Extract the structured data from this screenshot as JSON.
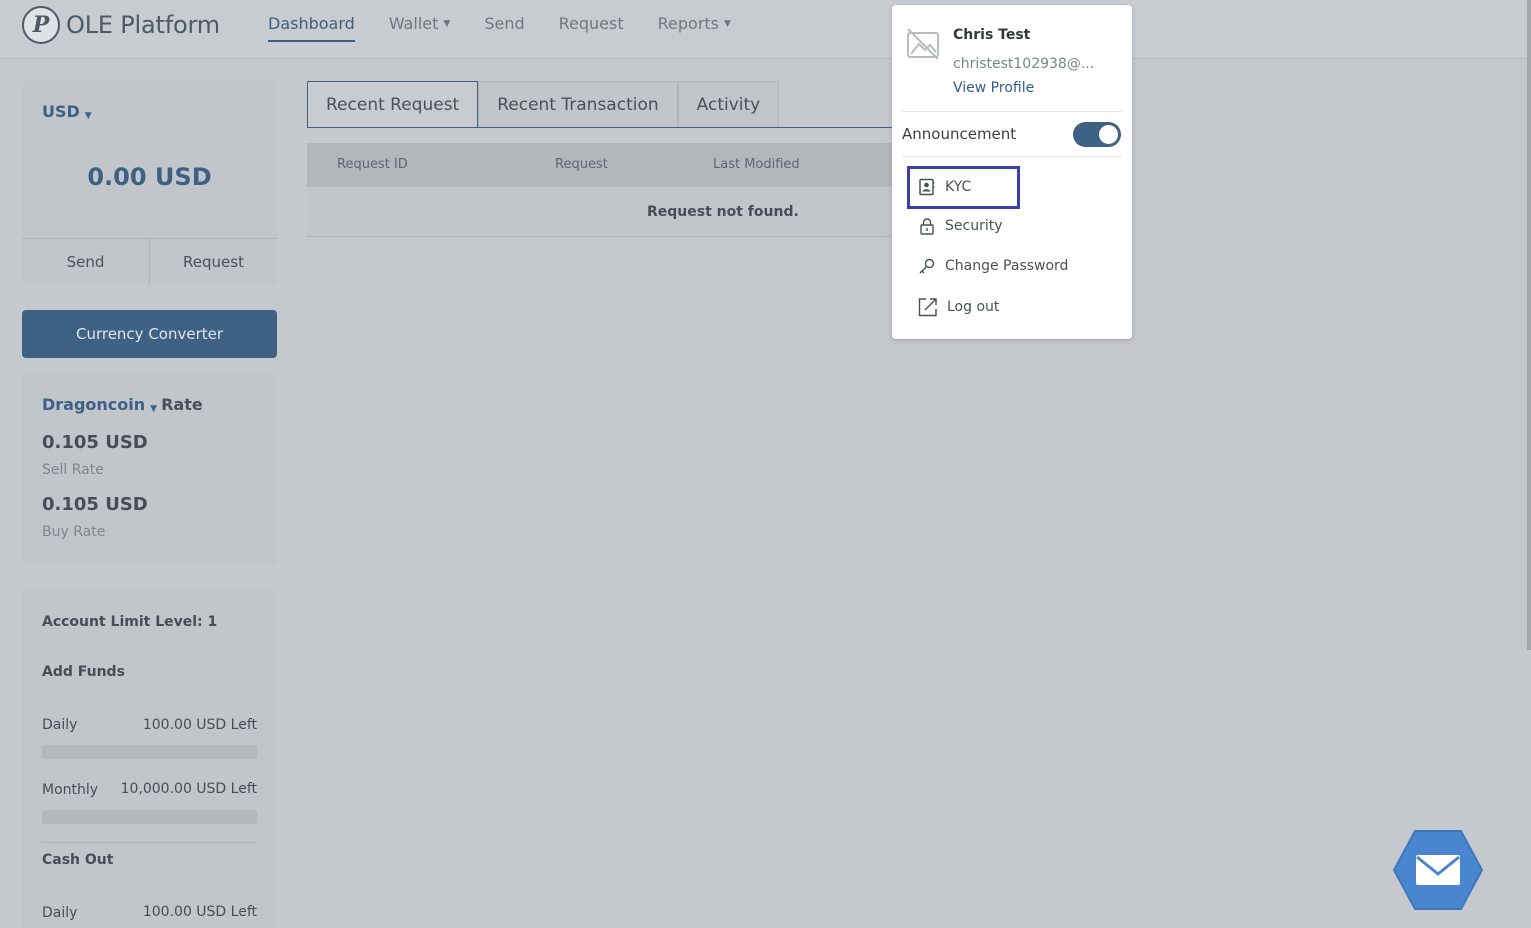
{
  "brand": {
    "logo_letter": "P",
    "name": "OLE Platform"
  },
  "nav": {
    "items": [
      {
        "label": "Dashboard",
        "active": true,
        "has_caret": false
      },
      {
        "label": "Wallet",
        "active": false,
        "has_caret": true
      },
      {
        "label": "Send",
        "active": false,
        "has_caret": false
      },
      {
        "label": "Request",
        "active": false,
        "has_caret": false
      },
      {
        "label": "Reports",
        "active": false,
        "has_caret": true
      }
    ]
  },
  "balance": {
    "currency": "USD",
    "amount": "0.00 USD",
    "send_label": "Send",
    "request_label": "Request"
  },
  "converter": {
    "label": "Currency Converter"
  },
  "rate": {
    "coin": "Dragoncoin",
    "rate_word": "Rate",
    "sell_value": "0.105 USD",
    "sell_label": "Sell Rate",
    "buy_value": "0.105 USD",
    "buy_label": "Buy Rate"
  },
  "limits": {
    "level_label": "Account Limit Level: 1",
    "add_funds_label": "Add Funds",
    "add_daily_label": "Daily",
    "add_daily_value": "100.00 USD Left",
    "add_daily_used_fraction": 0,
    "add_monthly_label": "Monthly",
    "add_monthly_value": "10,000.00 USD Left",
    "add_monthly_used_fraction": 0,
    "cash_out_label": "Cash Out",
    "cash_daily_label": "Daily",
    "cash_daily_value": "100.00 USD Left"
  },
  "tabs": [
    {
      "label": "Recent Request",
      "active": true
    },
    {
      "label": "Recent Transaction",
      "active": false
    },
    {
      "label": "Activity",
      "active": false
    }
  ],
  "table": {
    "columns": [
      "Request ID",
      "Request",
      "Last Modified"
    ],
    "empty_message": "Request not found."
  },
  "profile_menu": {
    "user_name": "Chris Test",
    "user_email": "christest102938@...",
    "view_profile": "View Profile",
    "announcement_label": "Announcement",
    "announcement_on": true,
    "items": [
      {
        "label": "KYC",
        "icon": "id-card-icon"
      },
      {
        "label": "Security",
        "icon": "lock-icon"
      },
      {
        "label": "Change Password",
        "icon": "key-icon"
      },
      {
        "label": "Log out",
        "icon": "external-link-icon"
      }
    ]
  },
  "colors": {
    "accent": "#3e6184",
    "highlight": "#3a3fae",
    "fab": "#4a86cf"
  }
}
